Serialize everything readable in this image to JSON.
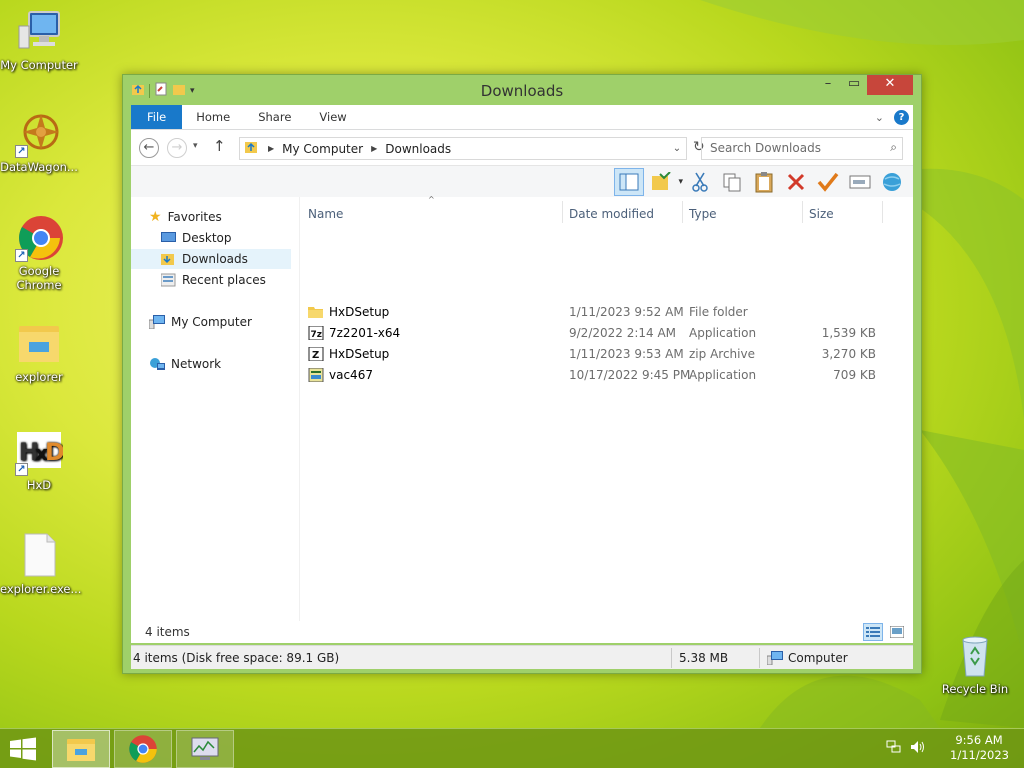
{
  "desktop": {
    "icons": [
      {
        "label": "My Computer"
      },
      {
        "label": "DataWagon..."
      },
      {
        "label": "Google Chrome"
      },
      {
        "label": "explorer"
      },
      {
        "label": "HxD"
      },
      {
        "label": "explorer.exe..."
      },
      {
        "label": "Recycle Bin"
      }
    ]
  },
  "window": {
    "title": "Downloads",
    "ribbon_tabs": [
      "File",
      "Home",
      "Share",
      "View"
    ],
    "address": {
      "crumbs": [
        "My Computer",
        "Downloads"
      ],
      "search_placeholder": "Search Downloads"
    },
    "navpane": {
      "favorites": "Favorites",
      "desktop": "Desktop",
      "downloads": "Downloads",
      "recent": "Recent places",
      "computer": "My Computer",
      "network": "Network"
    },
    "columns": {
      "name": "Name",
      "date": "Date modified",
      "type": "Type",
      "size": "Size"
    },
    "files": [
      {
        "name": "HxDSetup",
        "date": "1/11/2023 9:52 AM",
        "type": "File folder",
        "size": "",
        "icon": "folder-icon"
      },
      {
        "name": "7z2201-x64",
        "date": "9/2/2022 2:14 AM",
        "type": "Application",
        "size": "1,539 KB",
        "icon": "7zip-app-icon"
      },
      {
        "name": "HxDSetup",
        "date": "1/11/2023 9:53 AM",
        "type": "zip Archive",
        "size": "3,270 KB",
        "icon": "zip-archive-icon"
      },
      {
        "name": "vac467",
        "date": "10/17/2022 9:45 PM",
        "type": "Application",
        "size": "709 KB",
        "icon": "application-icon"
      }
    ],
    "status_items": "4 items",
    "bottom_status": {
      "left": "4 items (Disk free space: 89.1 GB)",
      "size": "5.38 MB",
      "location": "Computer"
    }
  },
  "taskbar": {
    "time": "9:56 AM",
    "date": "1/11/2023"
  },
  "colors": {
    "accent": "#1979ca",
    "window_frame": "#9fd06a",
    "close_button": "#c7463b"
  }
}
